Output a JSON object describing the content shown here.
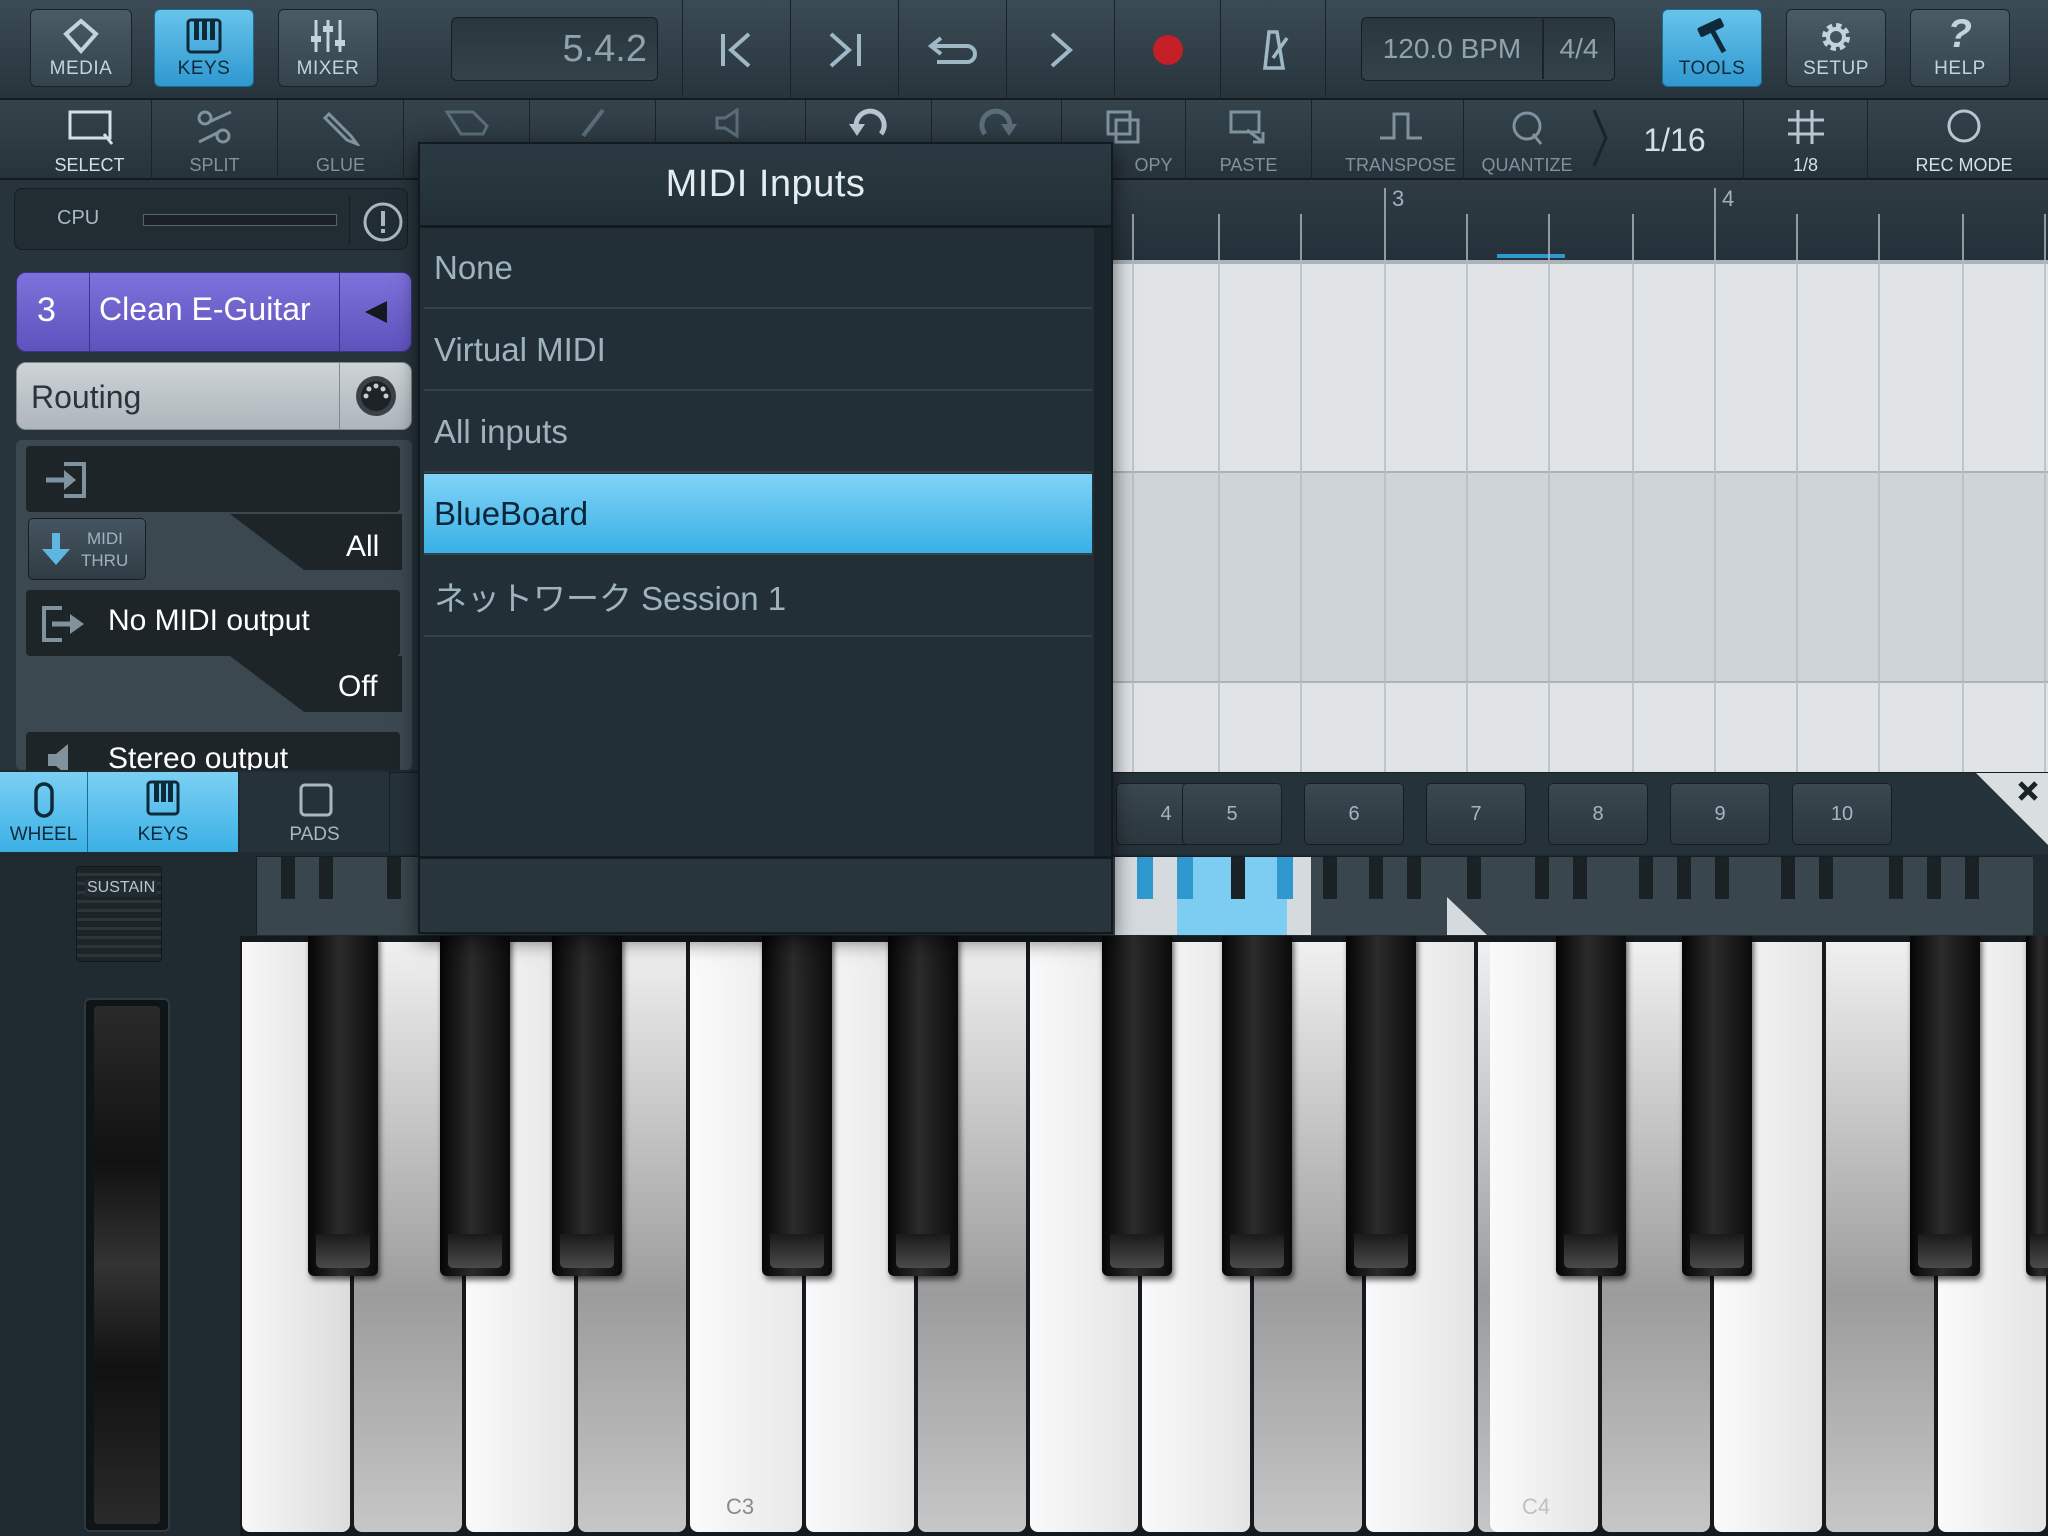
{
  "top_bar": {
    "media": "MEDIA",
    "keys": "KEYS",
    "mixer": "MIXER",
    "position": "5.4.2",
    "tempo": "120.0 BPM",
    "signature": "4/4",
    "tools": "TOOLS",
    "setup": "SETUP",
    "help": "HELP"
  },
  "toolbar": {
    "select": "SELECT",
    "split": "SPLIT",
    "glue": "GLUE",
    "copy": "OPY",
    "paste": "PASTE",
    "transpose": "TRANSPOSE",
    "quantize": "QUANTIZE",
    "quantize_value": "1/16",
    "grid": "1/8",
    "rec_mode": "REC MODE"
  },
  "left_panel": {
    "cpu_label": "CPU",
    "track_number": "3",
    "track_name": "Clean E-Guitar",
    "routing_label": "Routing",
    "midi_thru_line1": "MIDI",
    "midi_thru_line2": "THRU",
    "channel_value": "All",
    "midi_output": "No MIDI output",
    "output_channel": "Off",
    "audio_output": "Stereo output"
  },
  "arrange": {
    "bar_3": "3",
    "bar_4": "4"
  },
  "midi_inputs_popup": {
    "title": "MIDI Inputs",
    "items": [
      "None",
      "Virtual MIDI",
      "All inputs",
      "BlueBoard",
      "ネットワーク Session 1"
    ],
    "selected": "BlueBoard"
  },
  "key_tabs": {
    "wheel": "WHEEL",
    "keys": "KEYS",
    "pads": "PADS"
  },
  "octave_buttons": [
    "4",
    "5",
    "6",
    "7",
    "8",
    "9",
    "10"
  ],
  "sustain": "SUSTAIN",
  "key_labels": {
    "c3": "C3",
    "c4": "C4"
  },
  "colors": {
    "accent": "#3ab0e6",
    "track": "#6b5fc8"
  }
}
